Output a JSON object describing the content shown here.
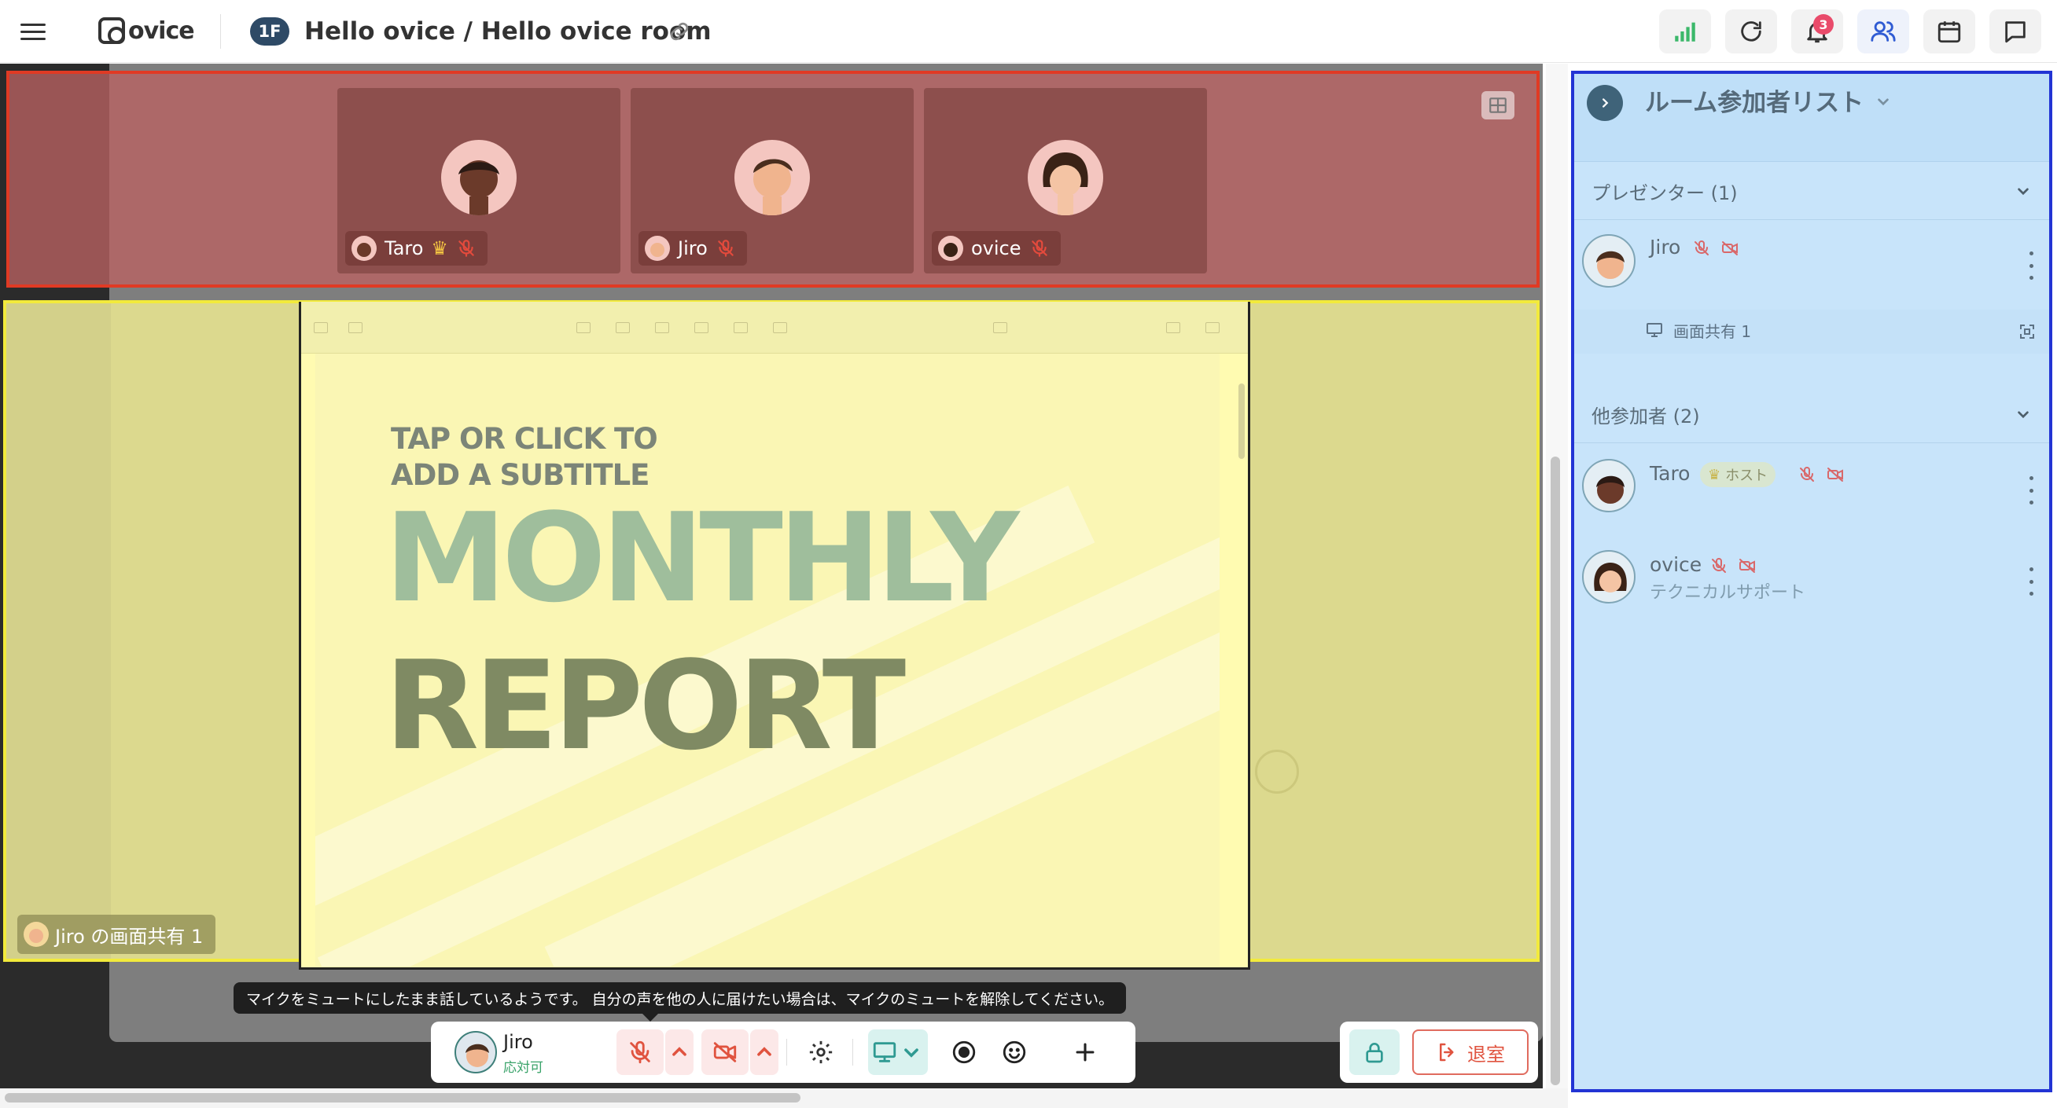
{
  "header": {
    "menu_icon": "hamburger-menu-icon",
    "logo_text": "ovice",
    "floor": "1F",
    "room_title": "Hello ovice / Hello ovice room",
    "link_icon": "link-icon",
    "buttons": [
      "signal-icon",
      "refresh-icon",
      "bell-icon",
      "people-icon",
      "calendar-icon",
      "chat-icon"
    ],
    "notification_count": "3"
  },
  "presenters": [
    {
      "name": "Taro",
      "host": true
    },
    {
      "name": "Jiro",
      "host": false
    },
    {
      "name": "ovice",
      "host": false
    }
  ],
  "share": {
    "label": "Jiro の画面共有 1",
    "slide_subtitle_line1": "TAP OR CLICK TO",
    "slide_subtitle_line2": "ADD A SUBTITLE",
    "slide_title_line1": "MONTHLY",
    "slide_title_line2": "REPORT"
  },
  "tooltip": "マイクをミュートにしたまま話しているようです。 自分の声を他の人に届けたい場合は、マイクのミュートを解除してください。",
  "controls": {
    "user_name": "Jiro",
    "user_status": "応対可",
    "leave_label": "退室"
  },
  "right_panel": {
    "title": "ルーム参加者リスト",
    "presenter_section": "プレゼンター (1)",
    "presenter": {
      "name": "Jiro",
      "share_label": "画面共有 1"
    },
    "others_section": "他参加者 (2)",
    "others": [
      {
        "name": "Taro",
        "badge": "ホスト",
        "subtitle": ""
      },
      {
        "name": "ovice",
        "badge": "",
        "subtitle": "テクニカルサポート"
      }
    ]
  },
  "colors": {
    "presenter_highlight": "#e03a24",
    "share_highlight": "#f2ea3c",
    "panel_highlight": "#2234d4",
    "accent_teal": "#3aa39a",
    "mute_red": "#e0533f"
  }
}
